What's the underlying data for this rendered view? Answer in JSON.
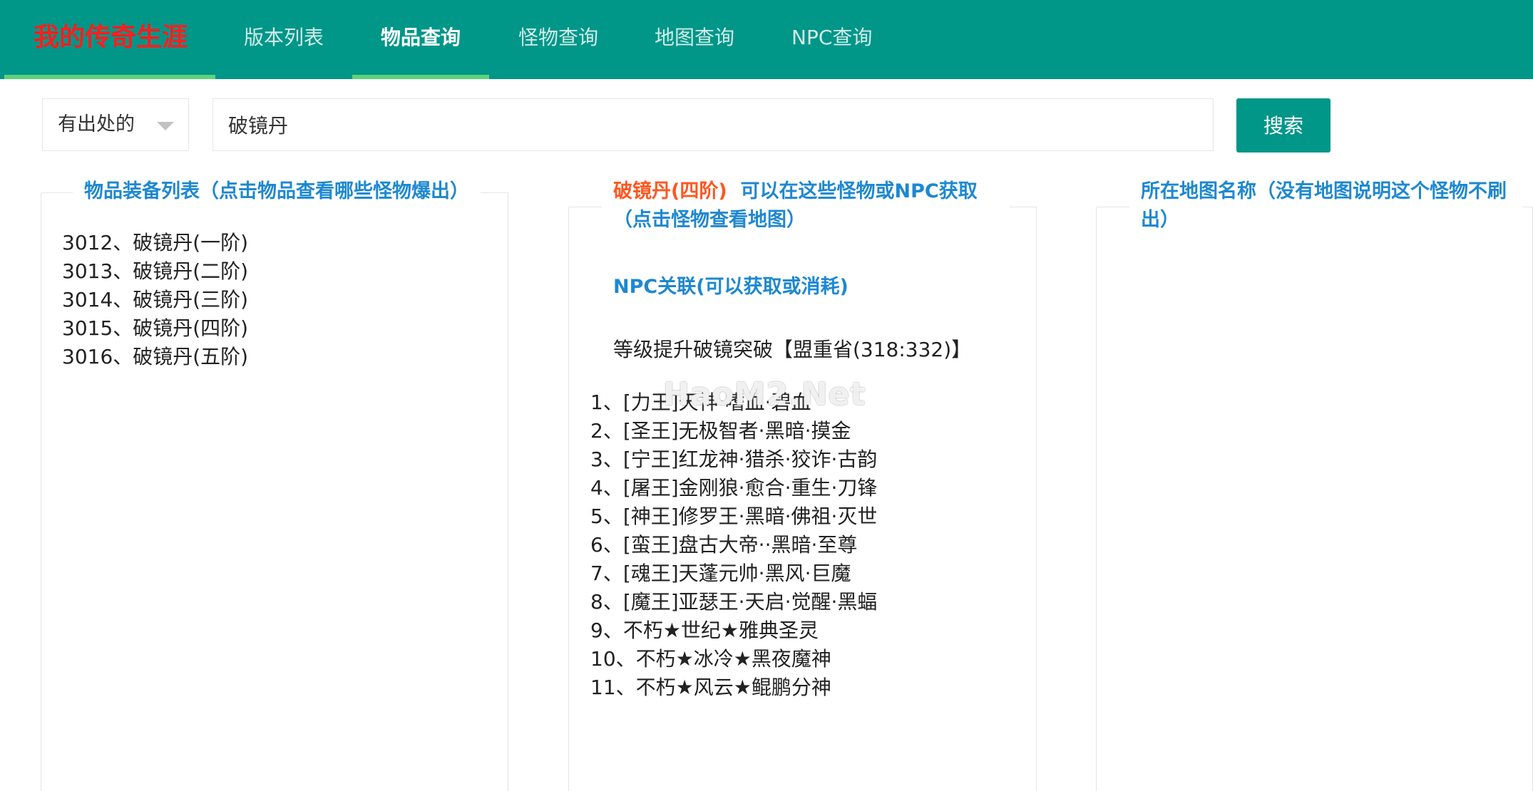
{
  "header": {
    "logo": "我的传奇生涯",
    "nav": [
      {
        "label": "版本列表"
      },
      {
        "label": "物品查询"
      },
      {
        "label": "怪物查询"
      },
      {
        "label": "地图查询"
      },
      {
        "label": "NPC查询"
      }
    ],
    "active_nav": "物品查询"
  },
  "search": {
    "filter_selected": "有出处的",
    "query_value": "破镜丹",
    "button_label": "搜索"
  },
  "items_panel": {
    "title": "物品装备列表（点击物品查看哪些怪物爆出）",
    "items": [
      "3012、破镜丹(一阶)",
      "3013、破镜丹(二阶)",
      "3014、破镜丹(三阶)",
      "3015、破镜丹(四阶)",
      "3016、破镜丹(五阶)"
    ]
  },
  "sources_panel": {
    "item_name": "破镜丹(四阶)",
    "title_rest": "可以在这些怪物或NPC获取",
    "title_line2": "（点击怪物查看地图）",
    "npc_title": "NPC关联(可以获取或消耗)",
    "npc_entry": "等级提升破镜突破【盟重省(318:332)】",
    "watermark": "HaoM2.Net",
    "monsters": [
      "1、[力王]天神·嗜血·碧血",
      "2、[圣王]无极智者·黑暗·摸金",
      "3、[宁王]红龙神·猎杀·狡诈·古韵",
      "4、[屠王]金刚狼·愈合·重生·刀锋",
      "5、[神王]修罗王·黑暗·佛祖·灭世",
      "6、[蛮王]盘古大帝··黑暗·至尊",
      "7、[魂王]天蓬元帅·黑风·巨魔",
      "8、[魔王]亚瑟王·天启·觉醒·黑蝠",
      "9、不朽★世纪★雅典圣灵",
      "10、不朽★冰冷★黑夜魔神",
      "11、不朽★风云★鲲鹏分神"
    ]
  },
  "map_panel": {
    "title": "所在地图名称（没有地图说明这个怪物不刷出）"
  },
  "colors": {
    "header_bg": "#009688",
    "logo": "#ff1e1e",
    "active_underline": "#5fd37b",
    "legend_blue": "#1e88d0",
    "item_highlight": "#ff5722"
  }
}
